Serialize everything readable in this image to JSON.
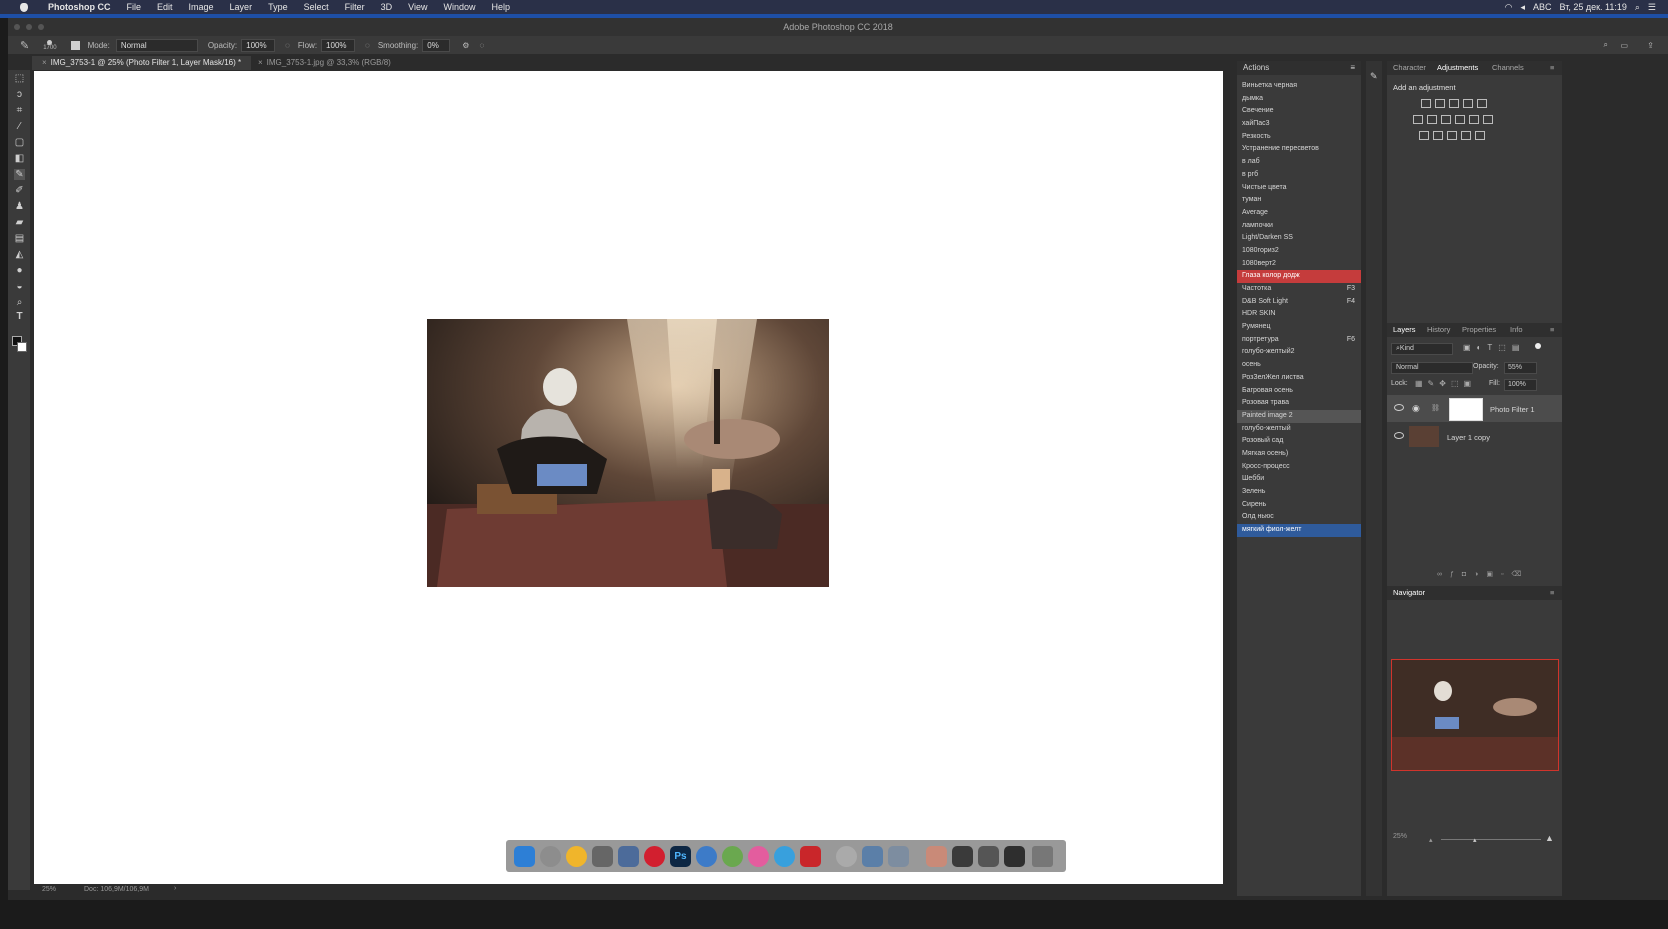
{
  "menubar": {
    "apple": "",
    "app_name": "Photoshop CC",
    "items": [
      "File",
      "Edit",
      "Image",
      "Layer",
      "Type",
      "Select",
      "Filter",
      "3D",
      "View",
      "Window",
      "Help"
    ],
    "right": {
      "lang": "ABC",
      "datetime": "Вт, 25 дек. 11:19"
    }
  },
  "window": {
    "title": "Adobe Photoshop CC 2018"
  },
  "options_bar": {
    "brush_size": "1700",
    "mode_label": "Mode:",
    "mode_value": "Normal",
    "opacity_label": "Opacity:",
    "opacity_value": "100%",
    "flow_label": "Flow:",
    "flow_value": "100%",
    "smoothing_label": "Smoothing:",
    "smoothing_value": "0%"
  },
  "tabs": [
    {
      "label": "IMG_3753-1 @ 25% (Photo Filter 1, Layer Mask/16) *",
      "active": true
    },
    {
      "label": "IMG_3753-1.jpg @ 33,3% (RGB/8)",
      "active": false
    }
  ],
  "status": {
    "zoom": "25%",
    "doc": "Doc: 106,9M/106,9M"
  },
  "actions_panel": {
    "title": "Actions",
    "items": [
      {
        "label": "Виньетка черная",
        "shortcut": "",
        "state": ""
      },
      {
        "label": "дымка",
        "shortcut": "",
        "state": ""
      },
      {
        "label": "Свечение",
        "shortcut": "",
        "state": ""
      },
      {
        "label": "хайПас3",
        "shortcut": "",
        "state": ""
      },
      {
        "label": "Резкость",
        "shortcut": "",
        "state": ""
      },
      {
        "label": "Устранение пересветов",
        "shortcut": "",
        "state": ""
      },
      {
        "label": "в лаб",
        "shortcut": "",
        "state": ""
      },
      {
        "label": "в ргб",
        "shortcut": "",
        "state": ""
      },
      {
        "label": "Чистые цвета",
        "shortcut": "",
        "state": ""
      },
      {
        "label": "туман",
        "shortcut": "",
        "state": ""
      },
      {
        "label": "Average",
        "shortcut": "",
        "state": ""
      },
      {
        "label": "лампочки",
        "shortcut": "",
        "state": ""
      },
      {
        "label": "Light/Darken SS",
        "shortcut": "",
        "state": ""
      },
      {
        "label": "1080гориз2",
        "shortcut": "",
        "state": ""
      },
      {
        "label": "1080верт2",
        "shortcut": "",
        "state": ""
      },
      {
        "label": "Глаза колор додж",
        "shortcut": "",
        "state": "red"
      },
      {
        "label": "Частотка",
        "shortcut": "F3",
        "state": ""
      },
      {
        "label": "D&B Soft Light",
        "shortcut": "F4",
        "state": ""
      },
      {
        "label": "HDR SKIN",
        "shortcut": "",
        "state": ""
      },
      {
        "label": "Румянец",
        "shortcut": "",
        "state": ""
      },
      {
        "label": "портретура",
        "shortcut": "F6",
        "state": ""
      },
      {
        "label": "голубо-желтый2",
        "shortcut": "",
        "state": ""
      },
      {
        "label": "осень",
        "shortcut": "",
        "state": ""
      },
      {
        "label": "РозЗелЖел листва",
        "shortcut": "",
        "state": ""
      },
      {
        "label": "Багровая осень",
        "shortcut": "",
        "state": ""
      },
      {
        "label": "Розовая трава",
        "shortcut": "",
        "state": ""
      },
      {
        "label": "Painted image 2",
        "shortcut": "",
        "state": "grey"
      },
      {
        "label": "голубо-желтый",
        "shortcut": "",
        "state": ""
      },
      {
        "label": "Розовый сад",
        "shortcut": "",
        "state": ""
      },
      {
        "label": "Мягкая осень)",
        "shortcut": "",
        "state": ""
      },
      {
        "label": "Кросс-процесс",
        "shortcut": "",
        "state": ""
      },
      {
        "label": "Шебби",
        "shortcut": "",
        "state": ""
      },
      {
        "label": "Зелень",
        "shortcut": "",
        "state": ""
      },
      {
        "label": "Сирень",
        "shortcut": "",
        "state": ""
      },
      {
        "label": "Олд ньюс",
        "shortcut": "",
        "state": ""
      },
      {
        "label": "мягкий фиол-желт",
        "shortcut": "",
        "state": "blue"
      }
    ]
  },
  "top_right_panel": {
    "tabs": [
      "Character",
      "Adjustments",
      "Channels"
    ],
    "active_tab": "Adjustments",
    "heading": "Add an adjustment"
  },
  "layers_panel": {
    "tabs": [
      "Layers",
      "History",
      "Properties",
      "Info"
    ],
    "active_tab": "Layers",
    "filter": "Kind",
    "blend_mode": "Normal",
    "opacity_label": "Opacity:",
    "opacity_value": "55%",
    "lock_label": "Lock:",
    "fill_label": "Fill:",
    "fill_value": "100%",
    "layers": [
      {
        "name": "Photo Filter 1",
        "selected": true
      },
      {
        "name": "Layer 1 copy",
        "selected": false
      }
    ]
  },
  "navigator": {
    "title": "Navigator",
    "zoom": "25%"
  },
  "dock": {
    "photoshop_label": "Ps"
  },
  "colors": {
    "accent_blue": "#2f5b9c",
    "action_red": "#c53c3c",
    "menubar": "#2a3048"
  }
}
